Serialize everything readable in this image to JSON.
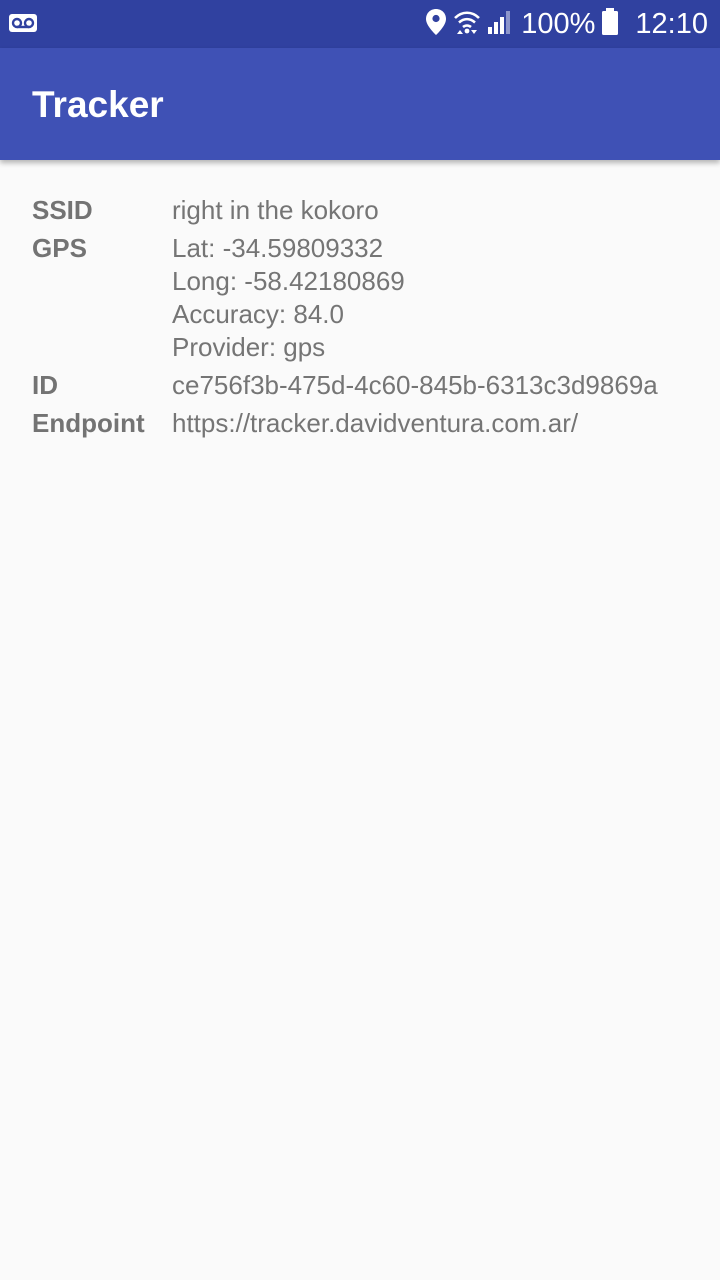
{
  "status_bar": {
    "left_icon": "voicemail-icon",
    "icons": [
      "location-icon",
      "wifi-icon",
      "cell-signal-icon",
      "battery-icon"
    ],
    "battery_text": "100%",
    "clock": "12:10"
  },
  "app_bar": {
    "title": "Tracker",
    "color": "#3f51b5",
    "status_color": "#3041a0"
  },
  "info": {
    "ssid": {
      "label": "SSID",
      "value": "right in the kokoro"
    },
    "gps": {
      "label": "GPS",
      "lat": "Lat: -34.59809332",
      "long": "Long: -58.42180869",
      "accuracy": "Accuracy: 84.0",
      "provider": "Provider: gps"
    },
    "id": {
      "label": "ID",
      "value": "ce756f3b-475d-4c60-845b-6313c3d9869a"
    },
    "endpoint": {
      "label": "Endpoint",
      "value": "https://tracker.davidventura.com.ar/"
    }
  }
}
